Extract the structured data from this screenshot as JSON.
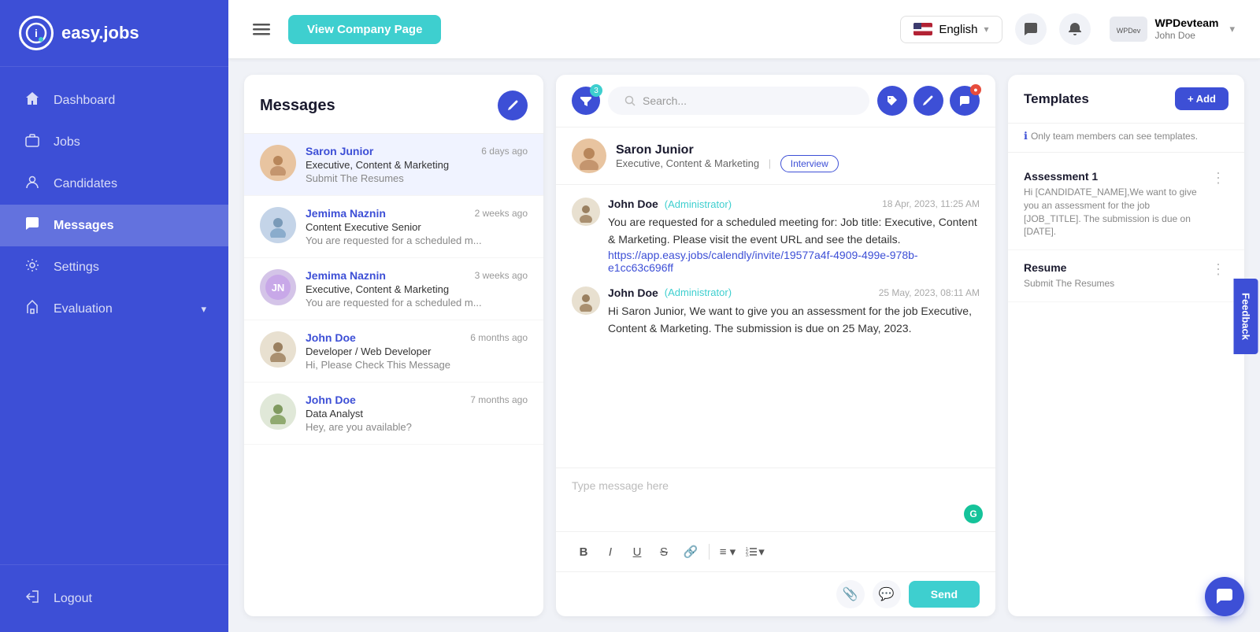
{
  "app": {
    "name": "easy.jobs",
    "logo_letter": "i"
  },
  "sidebar": {
    "items": [
      {
        "id": "dashboard",
        "label": "Dashboard",
        "icon": "🏠",
        "active": false
      },
      {
        "id": "jobs",
        "label": "Jobs",
        "icon": "💼",
        "active": false
      },
      {
        "id": "candidates",
        "label": "Candidates",
        "icon": "👤",
        "active": false
      },
      {
        "id": "messages",
        "label": "Messages",
        "icon": "💬",
        "active": true
      },
      {
        "id": "settings",
        "label": "Settings",
        "icon": "⚙️",
        "active": false
      },
      {
        "id": "evaluation",
        "label": "Evaluation",
        "icon": "🎓",
        "active": false
      }
    ],
    "logout_label": "Logout",
    "logout_icon": "🚪"
  },
  "header": {
    "company_btn": "View Company Page",
    "lang_label": "English",
    "user": {
      "team": "WPDevteam",
      "name": "John Doe"
    }
  },
  "messages": {
    "title": "Messages",
    "compose_icon": "✏️",
    "search_placeholder": "Search...",
    "conversations": [
      {
        "id": 1,
        "name": "Saron Junior",
        "role": "Executive, Content & Marketing",
        "preview": "Submit The Resumes",
        "time": "6 days ago",
        "active": true
      },
      {
        "id": 2,
        "name": "Jemima Naznin",
        "role": "Content Executive Senior",
        "preview": "You are requested for a scheduled m...",
        "time": "2 weeks ago",
        "active": false
      },
      {
        "id": 3,
        "name": "Jemima Naznin",
        "role": "Executive, Content & Marketing",
        "preview": "You are requested for a scheduled m...",
        "time": "3 weeks ago",
        "active": false
      },
      {
        "id": 4,
        "name": "John Doe",
        "role": "Developer / Web Developer",
        "preview": "Hi, Please Check This Message",
        "time": "6 months ago",
        "active": false
      },
      {
        "id": 5,
        "name": "John Doe",
        "role": "Data Analyst",
        "preview": "Hey, are you available?",
        "time": "7 months ago",
        "active": false
      }
    ]
  },
  "active_chat": {
    "name": "Saron Junior",
    "role": "Executive, Content & Marketing",
    "tag": "Interview",
    "messages": [
      {
        "id": 1,
        "sender": "John Doe",
        "role": "(Administrator)",
        "time": "18 Apr, 2023, 11:25 AM",
        "text": "You are requested for a scheduled meeting for: Job title: Executive, Content & Marketing. Please visit the event URL and see the details.",
        "link": "https://app.easy.jobs/calendly/invite/19577a4f-4909-499e-978b-e1cc63c696ff"
      },
      {
        "id": 2,
        "sender": "John Doe",
        "role": "(Administrator)",
        "time": "25 May, 2023, 08:11 AM",
        "text": "Hi Saron Junior, We want to give you an assessment for the job Executive, Content & Marketing. The submission is due on 25 May, 2023."
      }
    ],
    "composer_placeholder": "Type message here",
    "send_label": "Send"
  },
  "templates": {
    "title": "Templates",
    "add_label": "+ Add",
    "note": "Only team members can see templates.",
    "items": [
      {
        "id": 1,
        "name": "Assessment 1",
        "preview": "Hi [CANDIDATE_NAME],We want to give you an assessment for the job [JOB_TITLE]. The submission is due on [DATE]."
      },
      {
        "id": 2,
        "name": "Resume",
        "preview": "Submit The Resumes"
      }
    ]
  },
  "filter_count": "3",
  "feedback_label": "Feedback",
  "chat_support_icon": "💬"
}
